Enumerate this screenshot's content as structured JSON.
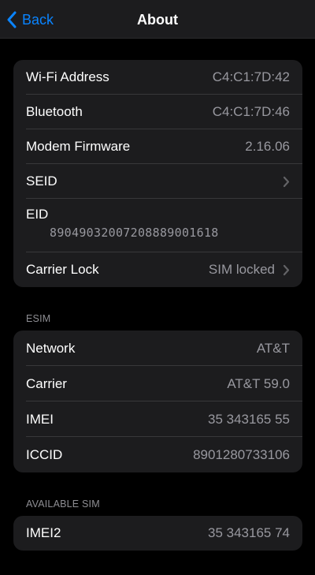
{
  "nav": {
    "back_label": "Back",
    "title": "About"
  },
  "device_group": {
    "wifi": {
      "label": "Wi-Fi Address",
      "value": "C4:C1:7D:42"
    },
    "bluetooth": {
      "label": "Bluetooth",
      "value": "C4:C1:7D:46"
    },
    "modem": {
      "label": "Modem Firmware",
      "value": "2.16.06"
    },
    "seid": {
      "label": "SEID"
    },
    "eid": {
      "label": "EID",
      "value": "89049032007208889001618"
    },
    "carrier_lock": {
      "label": "Carrier Lock",
      "value": "SIM locked"
    }
  },
  "esim_section": {
    "header": "ESIM",
    "network": {
      "label": "Network",
      "value": "AT&T"
    },
    "carrier": {
      "label": "Carrier",
      "value": "AT&T 59.0"
    },
    "imei": {
      "label": "IMEI",
      "value": "35 343165 55"
    },
    "iccid": {
      "label": "ICCID",
      "value": "8901280733106"
    }
  },
  "available_sim_section": {
    "header": "AVAILABLE SIM",
    "imei2": {
      "label": "IMEI2",
      "value": "35 343165 74"
    }
  },
  "colors": {
    "accent": "#0a84ff",
    "background": "#000000",
    "cell": "#1c1c1e",
    "secondary_text": "#98989f"
  },
  "icons": {
    "back": "chevron-left-icon",
    "disclosure": "chevron-right-icon"
  }
}
